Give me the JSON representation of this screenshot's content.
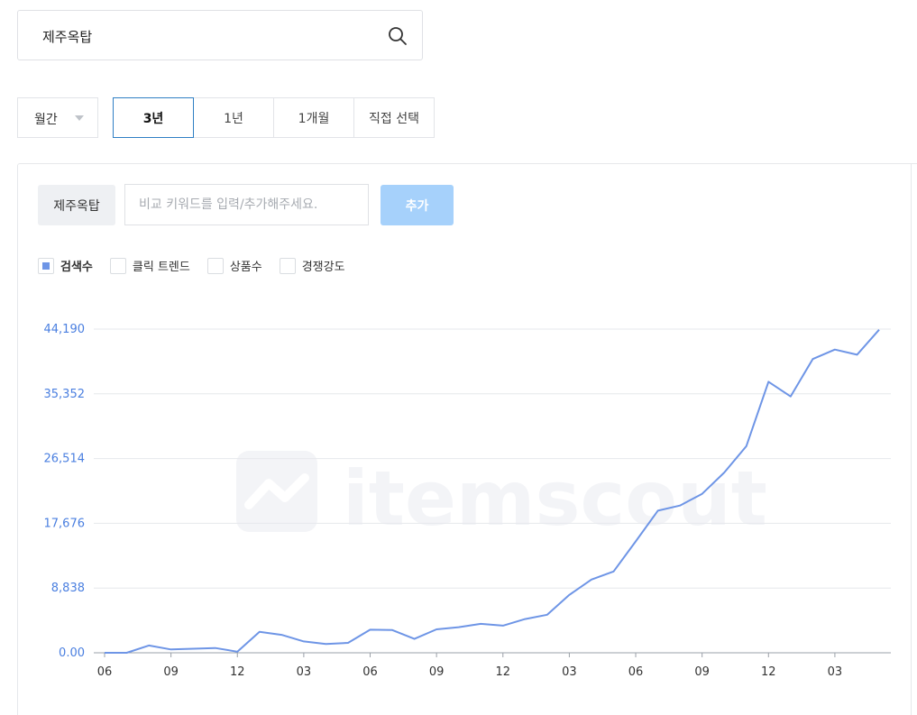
{
  "search": {
    "query": "제주옥탑"
  },
  "period": {
    "selected": "월간"
  },
  "range_tabs": [
    {
      "label": "3년",
      "active": true
    },
    {
      "label": "1년",
      "active": false
    },
    {
      "label": "1개월",
      "active": false
    },
    {
      "label": "직접 선택",
      "active": false
    }
  ],
  "compare": {
    "keyword": "제주옥탑",
    "placeholder": "비교 키워드를 입력/추가해주세요.",
    "add_label": "추가"
  },
  "legend": [
    {
      "label": "검색수",
      "checked": true
    },
    {
      "label": "클릭 트렌드",
      "checked": false
    },
    {
      "label": "상품수",
      "checked": false
    },
    {
      "label": "경쟁강도",
      "checked": false
    }
  ],
  "watermark": "itemscout",
  "chart_data": {
    "type": "line",
    "series": [
      {
        "name": "검색수",
        "color": "#6e95e6",
        "values": [
          0,
          0,
          1000,
          450,
          550,
          650,
          150,
          2850,
          2450,
          1550,
          1200,
          1350,
          3150,
          3100,
          1900,
          3200,
          3500,
          3950,
          3700,
          4600,
          5200,
          7900,
          10000,
          11100,
          15200,
          19400,
          20100,
          21700,
          24600,
          28200,
          37000,
          35000,
          40100,
          41400,
          40700,
          44100
        ]
      }
    ],
    "x_tick_labels": [
      "06",
      "09",
      "12",
      "03",
      "06",
      "09",
      "12",
      "03",
      "06",
      "09",
      "12",
      "03"
    ],
    "x_tick_positions": [
      0,
      3,
      6,
      9,
      12,
      15,
      18,
      21,
      24,
      27,
      30,
      33
    ],
    "y_tick_labels": [
      "44,190",
      "35,352",
      "26,514",
      "17,676",
      "8,838",
      "0.00"
    ],
    "ylim": [
      0,
      44190
    ],
    "grid": true
  }
}
